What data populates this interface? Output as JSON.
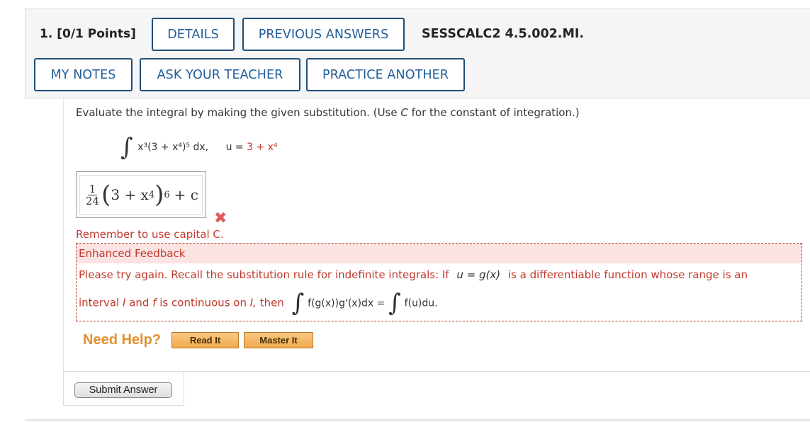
{
  "header": {
    "question_number": "1.",
    "points": "[0/1 Points]",
    "buttons": {
      "details": "DETAILS",
      "previous_answers": "PREVIOUS ANSWERS",
      "my_notes": "MY NOTES",
      "ask_teacher": "ASK YOUR TEACHER",
      "practice_another": "PRACTICE ANOTHER"
    },
    "problem_code": "SESSCALC2 4.5.002.MI."
  },
  "question": {
    "prompt_before_c": "Evaluate the integral by making the given substitution. (Use ",
    "prompt_c": "C",
    "prompt_after_c": " for the constant of integration.)",
    "integrand": "x³(3 + x⁴)⁵ dx,",
    "substitution_lhs": "u = ",
    "substitution_rhs": "3 + x⁴"
  },
  "answer": {
    "frac_num": "1",
    "frac_den": "24",
    "expr_inner": "3 + x",
    "expr_inner_power": "4",
    "expr_power": "6",
    "expr_tail": "+ c",
    "status_icon": "incorrect-x-icon"
  },
  "feedback": {
    "reminder": "Remember to use capital C.",
    "heading": "Enhanced Feedback",
    "line1": "Please try again. Recall the substitution rule for indefinite integrals: If",
    "line1_math": "u = g(x)",
    "line1_end": "is a differentiable function whose range is an",
    "line2_start": "interval",
    "line2_I": "I",
    "line2_and": "and",
    "line2_f": "f",
    "line2_cont": "is continuous on",
    "line2_I2": "I,",
    "line2_then": "then",
    "line2_lhs": "f(g(x))g'(x)dx =",
    "line2_rhs": "f(u)du."
  },
  "help": {
    "label": "Need Help?",
    "read_it": "Read It",
    "master_it": "Master It"
  },
  "submit": {
    "label": "Submit Answer"
  },
  "colors": {
    "accent_blue": "#1f5c99",
    "error_red": "#c0392b",
    "help_orange": "#e0912f"
  }
}
